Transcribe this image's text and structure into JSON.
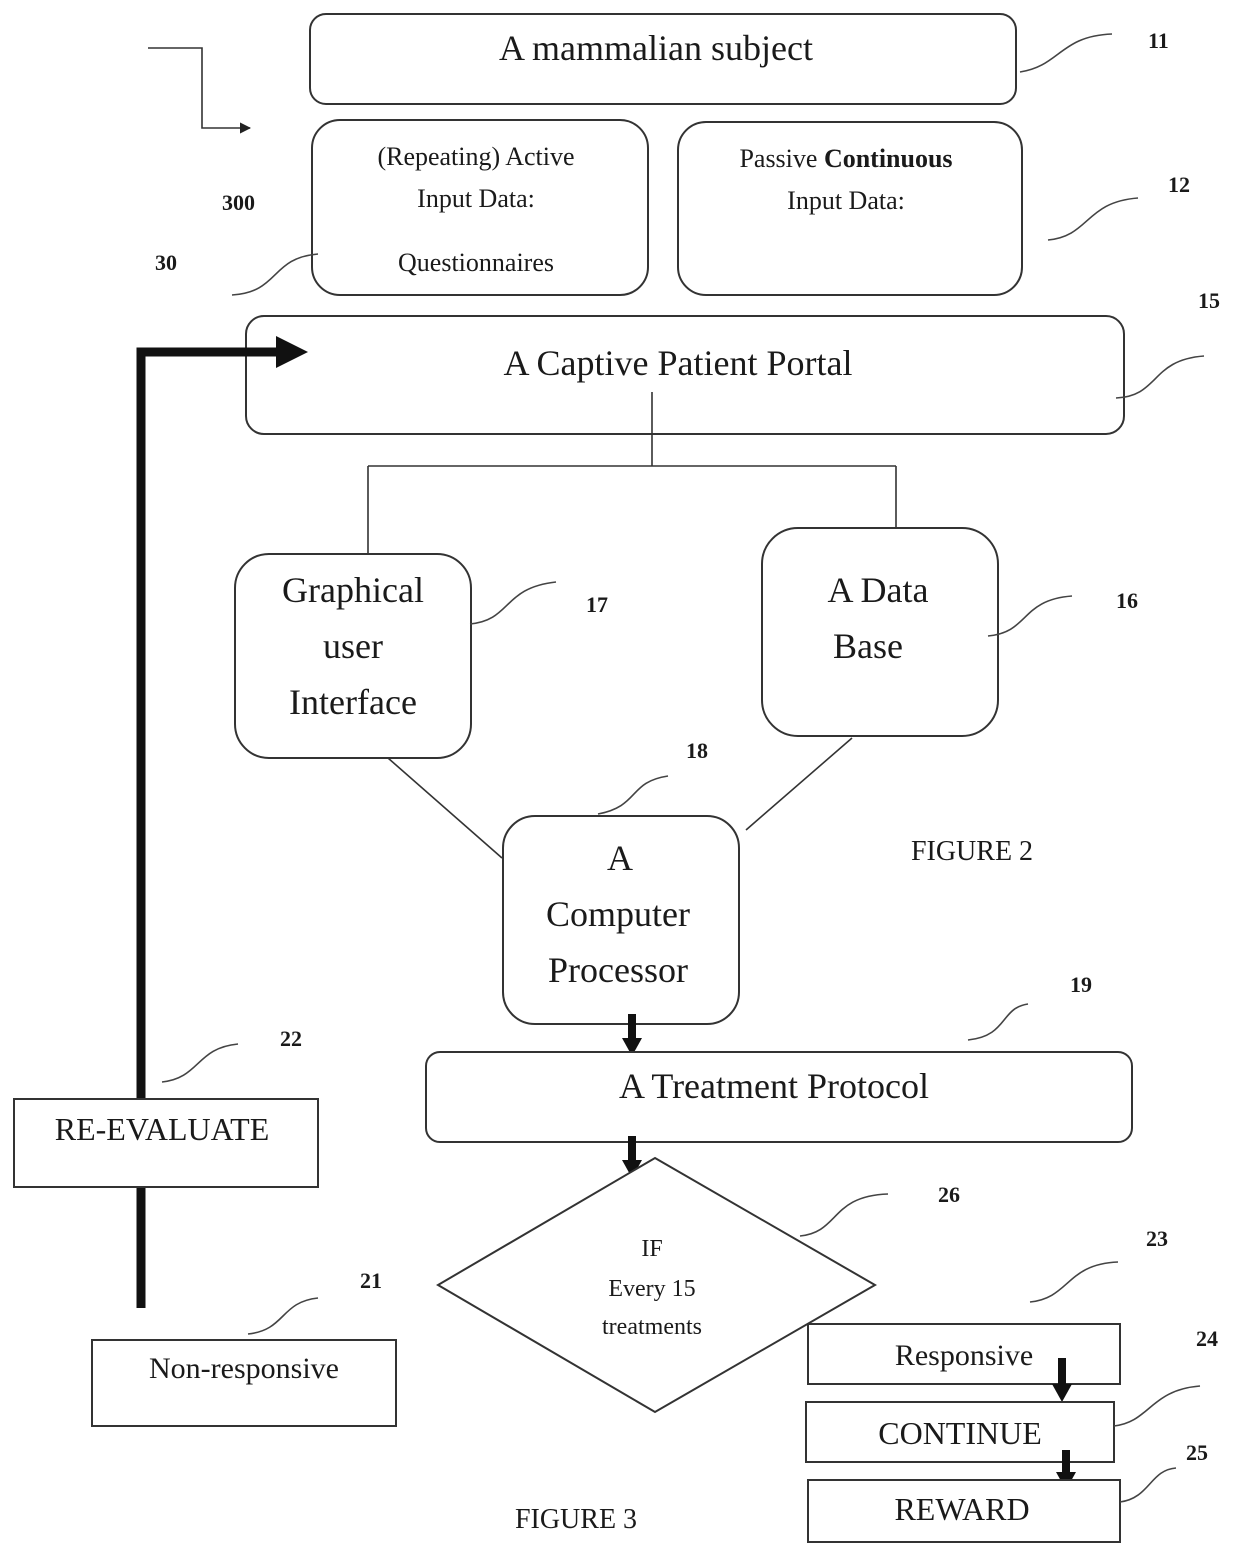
{
  "figure2": {
    "caption": "FIGURE 2",
    "subject": {
      "label": "A mammalian subject",
      "ref": "11"
    },
    "active_input": {
      "line1": "(Repeating) Active",
      "line2": "Input Data:",
      "line3": "Questionnaires",
      "ref": "30",
      "ref_outer": "300"
    },
    "passive_input": {
      "line1_plain": "Passive ",
      "line1_bold": "Continuous",
      "line2": "Input Data:",
      "ref": "12"
    },
    "portal": {
      "label": "A Captive Patient Portal",
      "ref": "15"
    },
    "gui": {
      "line1": "Graphical",
      "line2": "user",
      "line3": "Interface",
      "ref": "17"
    },
    "database": {
      "line1": "A Data",
      "line2": "Base",
      "ref": "16"
    },
    "processor": {
      "line1": "A",
      "line2": "Computer",
      "line3": "Processor",
      "ref": "18"
    }
  },
  "figure3": {
    "caption": "FIGURE 3",
    "treatment": {
      "label": "A Treatment Protocol",
      "ref": "19"
    },
    "decision": {
      "line1": "IF",
      "line2": "Every 15",
      "line3": "treatments",
      "ref": "26"
    },
    "non_responsive": {
      "label": "Non-responsive",
      "ref": "21"
    },
    "re_evaluate": {
      "label": "RE-EVALUATE",
      "ref": "22"
    },
    "responsive": {
      "label": "Responsive",
      "ref": "23"
    },
    "continue": {
      "label": "CONTINUE",
      "ref": "24"
    },
    "reward": {
      "label": "REWARD",
      "ref": "25"
    }
  }
}
